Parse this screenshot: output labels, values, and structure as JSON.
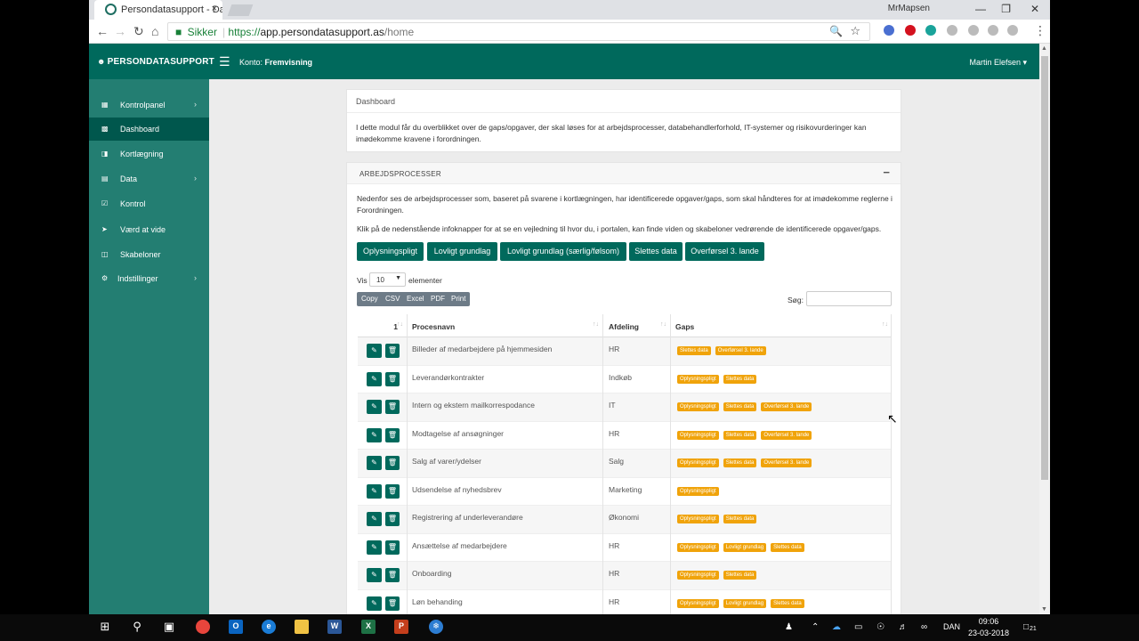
{
  "browser": {
    "tab_title": "Persondatasupport - Das",
    "tab_close": "×",
    "user_profile": "MrMapsen",
    "url_secure_label": "Sikker",
    "url_scheme": "https://",
    "url_host": "app.persondatasupport.as",
    "url_path": "/home",
    "nav_back": "←",
    "nav_forward": "→",
    "nav_reload": "↻",
    "nav_home": "⌂",
    "zoom_icon": "🔍",
    "star_icon": "☆",
    "menu_icon": "⋮",
    "win_min": "—",
    "win_restore": "❐",
    "win_close": "✕"
  },
  "app": {
    "brand": "PERSONDATASUPPORT",
    "konto_label": "Konto:",
    "konto_value": "Fremvisning",
    "user_menu": "Martin Elefsen ▾",
    "accent_color": "#00695c",
    "sidebar_color": "#237e72",
    "badge_color": "#f0a30a"
  },
  "sidebar": {
    "items": [
      {
        "label": "Kontrolpanel",
        "icon": "grid-icon",
        "chev": "›",
        "active": false
      },
      {
        "label": "Dashboard",
        "icon": "dashboard-icon",
        "chev": "",
        "active": true
      },
      {
        "label": "Kortlægning",
        "icon": "map-icon",
        "chev": "",
        "active": false
      },
      {
        "label": "Data",
        "icon": "table-icon",
        "chev": "›",
        "active": false
      },
      {
        "label": "Kontrol",
        "icon": "check-icon",
        "chev": "",
        "active": false
      },
      {
        "label": "Værd at vide",
        "icon": "rocket-icon",
        "chev": "",
        "active": false
      },
      {
        "label": "Skabeloner",
        "icon": "file-icon",
        "chev": "",
        "active": false
      },
      {
        "label": "Indstillinger",
        "icon": "gear-icon",
        "chev": "›",
        "active": false
      }
    ]
  },
  "dashboard": {
    "breadcrumb": "Dashboard",
    "intro": "I dette modul får du overblikket over de gaps/opgaver, der skal løses for at arbejdsprocesser, databehandlerforhold, IT-systemer og risikovurderinger kan imødekomme kravene i forordningen."
  },
  "arbejdsprocesser": {
    "title": "ARBEJDSPROCESSER",
    "collapse": "−",
    "p1": "Nedenfor ses de arbejdsprocesser som, baseret på svarene i kortlægningen, har identificerede opgaver/gaps, som skal håndteres for at imødekomme reglerne i Forordningen.",
    "p2": "Klik på de nedenstående infoknapper for at se en vejledning til hvor du, i portalen, kan finde viden og skabeloner vedrørende de identificerede opgaver/gaps.",
    "info_buttons": [
      "Oplysningspligt",
      "Lovligt grundlag",
      "Lovligt grundlag (særlig/følsom)",
      "Slettes data",
      "Overførsel 3. lande"
    ],
    "vis_label": "Vis",
    "vis_value": "10",
    "elementer_label": "elementer",
    "export_buttons": [
      "Copy",
      "CSV",
      "Excel",
      "PDF",
      "Print"
    ],
    "search_label": "Søg:",
    "search_value": "",
    "columns": [
      "1",
      "Procesnavn",
      "Afdeling",
      "Gaps"
    ],
    "sort_icon": "↑↓",
    "edit_icon": "✎",
    "delete_icon": "🗑",
    "rows": [
      {
        "name": "Billeder af medarbejdere på hjemmesiden",
        "dept": "HR",
        "gaps": [
          "Slettes data",
          "Overførsel 3. lande"
        ]
      },
      {
        "name": "Leverandørkontrakter",
        "dept": "Indkøb",
        "gaps": [
          "Oplysningspligt",
          "Slettes data"
        ]
      },
      {
        "name": "Intern og ekstern mailkorrespodance",
        "dept": "IT",
        "gaps": [
          "Oplysningspligt",
          "Slettes data",
          "Overførsel 3. lande"
        ]
      },
      {
        "name": "Modtagelse af ansøgninger",
        "dept": "HR",
        "gaps": [
          "Oplysningspligt",
          "Slettes data",
          "Overførsel 3. lande"
        ]
      },
      {
        "name": "Salg af varer/ydelser",
        "dept": "Salg",
        "gaps": [
          "Oplysningspligt",
          "Slettes data",
          "Overførsel 3. lande"
        ]
      },
      {
        "name": "Udsendelse af nyhedsbrev",
        "dept": "Marketing",
        "gaps": [
          "Oplysningspligt"
        ]
      },
      {
        "name": "Registrering af underleverandøre",
        "dept": "Økonomi",
        "gaps": [
          "Oplysningspligt",
          "Slettes data"
        ]
      },
      {
        "name": "Ansættelse af medarbejdere",
        "dept": "HR",
        "gaps": [
          "Oplysningspligt",
          "Lovligt grundlag",
          "Slettes data"
        ]
      },
      {
        "name": "Onboarding",
        "dept": "HR",
        "gaps": [
          "Oplysningspligt",
          "Slettes data"
        ]
      },
      {
        "name": "Løn behanding",
        "dept": "HR",
        "gaps": [
          "Oplysningspligt",
          "Lovligt grundlag",
          "Slettes data"
        ]
      }
    ]
  },
  "taskbar": {
    "lang": "DAN",
    "time": "09:06",
    "date": "23-03-2018",
    "notif_count": "21"
  }
}
